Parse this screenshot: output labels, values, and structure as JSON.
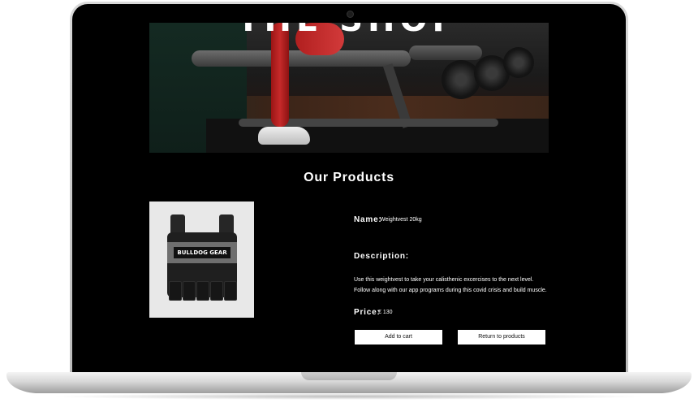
{
  "hero": {
    "title": "THE SHOP"
  },
  "section": {
    "title": "Our Products"
  },
  "product": {
    "image_label": "BULLDOG GEAR",
    "name_label": "Name:",
    "name_value": "Weightvest 20kg",
    "description_label": "Description:",
    "description_line1": "Use this weightvest to take your calisthenic excercises to the next level.",
    "description_line2": "Follow along with our app programs during this covid crisis and build muscle.",
    "price_label": "Price:",
    "price_value": "€ 130"
  },
  "actions": {
    "add_to_cart": "Add to cart",
    "return_to_products": "Return to products"
  }
}
